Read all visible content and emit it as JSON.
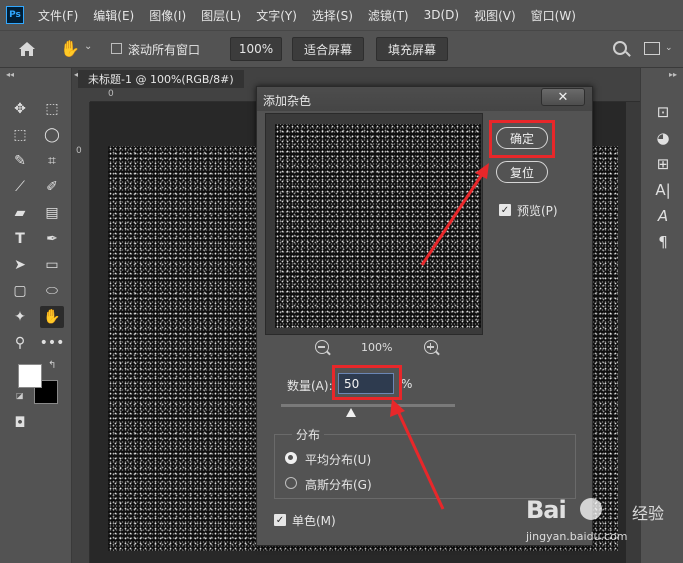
{
  "app": {
    "logo_text": "Ps",
    "menu": [
      "文件(F)",
      "编辑(E)",
      "图像(I)",
      "图层(L)",
      "文字(Y)",
      "选择(S)",
      "滤镜(T)",
      "3D(D)",
      "视图(V)",
      "窗口(W)"
    ]
  },
  "options_bar": {
    "scroll_all_label": "滚动所有窗口",
    "zoom_value": "100%",
    "fit_screen_label": "适合屏幕",
    "fill_screen_label": "填充屏幕"
  },
  "document": {
    "tab_title": "未标题-1 @ 100%(RGB/8#)",
    "ruler_top_zero": "0",
    "ruler_left_zero": "0"
  },
  "dialog": {
    "title": "添加杂色",
    "close_symbol": "✕",
    "ok_label": "确定",
    "reset_label": "复位",
    "preview_label": "预览(P)",
    "preview_checked": true,
    "zoom_level": "100%",
    "amount_label": "数量(A):",
    "amount_value": "50",
    "amount_unit": "%",
    "amount_slider_fraction": 0.4,
    "distribution_title": "分布",
    "uniform_label": "平均分布(U)",
    "gaussian_label": "高斯分布(G)",
    "selected_distribution": "uniform",
    "monochromatic_label": "单色(M)",
    "monochromatic_checked": true
  },
  "colors": {
    "foreground": "#ffffff",
    "background": "#000000",
    "annotation_red": "#e8272a"
  },
  "watermark": {
    "brand": "Bai",
    "brand_suffix": "经验",
    "url": "jingyan.baidu.com"
  }
}
